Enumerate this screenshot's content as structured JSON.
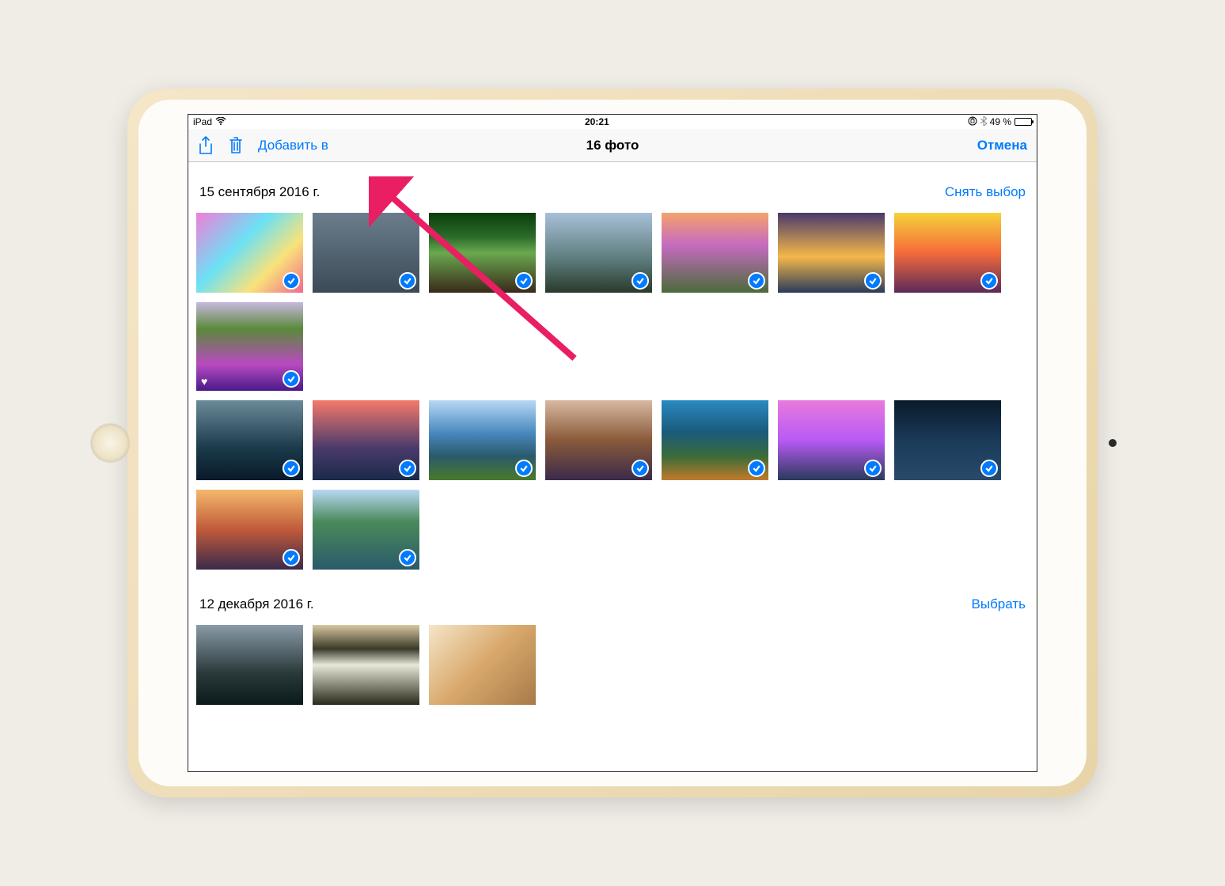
{
  "status": {
    "device": "iPad",
    "time": "20:21",
    "battery_text": "49 %"
  },
  "nav": {
    "add_to": "Добавить в",
    "title": "16 фото",
    "cancel": "Отмена"
  },
  "sections": [
    {
      "title": "15 сентября 2016 г.",
      "action": "Снять выбор",
      "photos": [
        {
          "selected": true,
          "favorite": false,
          "bg": "linear-gradient(135deg,#f07ed8,#6ce1f5 40%,#f9e27a 70%,#f06a8c)"
        },
        {
          "selected": true,
          "favorite": false,
          "bg": "linear-gradient(#6b7d8c,#3b4a56)"
        },
        {
          "selected": true,
          "favorite": false,
          "bg": "linear-gradient(#0b3d0b,#2a6b2a 30%,#6aa84f 50%,#3a2a1a)"
        },
        {
          "selected": true,
          "favorite": false,
          "bg": "linear-gradient(#a8c0d8,#5a7a7a 60%,#2a3a2a)"
        },
        {
          "selected": true,
          "favorite": false,
          "bg": "linear-gradient(#f5a26b,#c76bc0 40%,#4a6b3a)"
        },
        {
          "selected": true,
          "favorite": false,
          "bg": "linear-gradient(#4a3a6b,#f5b84a 55%,#2a3a5a)"
        },
        {
          "selected": true,
          "favorite": false,
          "bg": "linear-gradient(#f5d23a,#f56b3a 50%,#5a2a5a)"
        },
        {
          "selected": true,
          "favorite": true,
          "bg": "linear-gradient(#c8b8e0,#5a8a3a 30%,#b84ac0 70%,#4a1a8a)"
        },
        {
          "selected": true,
          "favorite": false,
          "bg": "linear-gradient(#6b8a9a,#1a3a4a 60%,#0a1a2a)"
        },
        {
          "selected": true,
          "favorite": false,
          "bg": "linear-gradient(#f57a6b,#4a3a6b 60%,#1a2a4a)"
        },
        {
          "selected": true,
          "favorite": false,
          "bg": "linear-gradient(#b8d8f5,#4a8ac0 40%,#2a5a6b 70%,#4a7a2a)"
        },
        {
          "selected": true,
          "favorite": false,
          "bg": "linear-gradient(#d8b8a0,#8a5a3a 50%,#3a2a4a)"
        },
        {
          "selected": true,
          "favorite": false,
          "bg": "linear-gradient(#2a8ac0,#1a5a7a 40%,#3a6b3a 70%,#c07a2a)"
        },
        {
          "selected": true,
          "favorite": false,
          "bg": "linear-gradient(#e87adc,#b85af5 50%,#2a3a5a)"
        },
        {
          "selected": true,
          "favorite": false,
          "bg": "linear-gradient(#0a1a2a,#1a3a5a 50%,#2a4a6b)"
        },
        {
          "selected": true,
          "favorite": false,
          "bg": "linear-gradient(#f5b86b,#c05a3a 50%,#3a2a4a)"
        },
        {
          "selected": true,
          "favorite": false,
          "bg": "linear-gradient(#b8d8f5,#4a8a5a 40%,#2a5a6b)"
        }
      ],
      "row_breaks": [
        8,
        15
      ]
    },
    {
      "title": "12 декабря 2016 г.",
      "action": "Выбрать",
      "photos": [
        {
          "selected": false,
          "favorite": false,
          "bg": "linear-gradient(#8a9aa8,#2a3a3a 60%,#0a1a1a)"
        },
        {
          "selected": false,
          "favorite": false,
          "bg": "linear-gradient(#d8c8a0,#3a3a2a 30%,#e8e8d8 50%,#2a2a1a)"
        },
        {
          "selected": false,
          "favorite": false,
          "bg": "linear-gradient(135deg,#f5e6c8,#d8a86b 50%,#a87a4a)"
        }
      ],
      "row_breaks": []
    }
  ],
  "colors": {
    "accent": "#007aff"
  }
}
